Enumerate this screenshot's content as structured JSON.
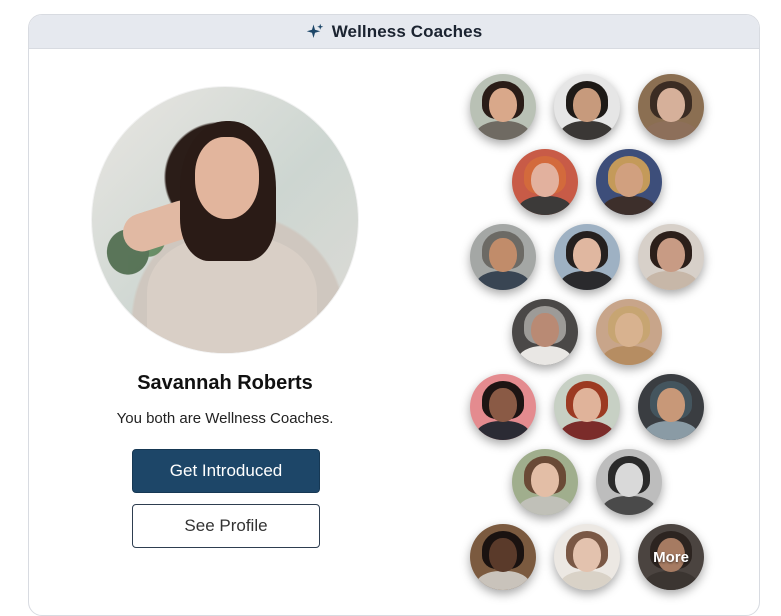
{
  "header": {
    "title": "Wellness Coaches",
    "icon": "sparkle-icon"
  },
  "profile": {
    "name": "Savannah Roberts",
    "subtitle": "You both are Wellness Coaches.",
    "primary_button": "Get Introduced",
    "secondary_button": "See Profile"
  },
  "colors": {
    "primary": "#1d4668",
    "header_bg": "#e6e9ef",
    "border": "#d8dbe1"
  },
  "avatars": [
    {
      "skin": "#d9a88a",
      "hair": "#2a1c17",
      "body": "#6f6a62",
      "bg": "#b9c1b5"
    },
    {
      "skin": "#c79a7c",
      "hair": "#1e1a17",
      "body": "#3a3735",
      "bg": "#e6e6e6"
    },
    {
      "skin": "#d6b09a",
      "hair": "#3b2c23",
      "body": "#8d6f5a",
      "bg": "#8b6f52"
    },
    {
      "skin": "#e2b19e",
      "hair": "#d36a3c",
      "body": "#3c3a39",
      "bg": "#c85b47"
    },
    {
      "skin": "#d1a07f",
      "hair": "#c49a5a",
      "body": "#3d2f2b",
      "bg": "#3d4e7a"
    },
    {
      "skin": "#c18c6a",
      "hair": "#6c6a65",
      "body": "#394553",
      "bg": "#a4a7a5"
    },
    {
      "skin": "#e0b7a0",
      "hair": "#25201f",
      "body": "#2a2a2d",
      "bg": "#9eb1c3"
    },
    {
      "skin": "#c89b84",
      "hair": "#2c1f1a",
      "body": "#c7b7a8",
      "bg": "#d7d0c9"
    },
    {
      "skin": "#b98a74",
      "hair": "#9d9b98",
      "body": "#e9e7e4",
      "bg": "#4a4847"
    },
    {
      "skin": "#d8b28f",
      "hair": "#c7a572",
      "body": "#b68d62",
      "bg": "#c8a58a"
    },
    {
      "skin": "#8a5a45",
      "hair": "#1d1413",
      "body": "#2b2b34",
      "bg": "#e48b8f"
    },
    {
      "skin": "#e0b39a",
      "hair": "#9c3a22",
      "body": "#7b2c2a",
      "bg": "#c7d0c4"
    },
    {
      "skin": "#c89878",
      "hair": "#44555e",
      "body": "#8a9ba5",
      "bg": "#3a3d41"
    },
    {
      "skin": "#e3bea6",
      "hair": "#6a4a36",
      "body": "#c0c0b8",
      "bg": "#a0ae8d"
    },
    {
      "skin": "#d9d9d9",
      "hair": "#2a2a2a",
      "body": "#4a4a4a",
      "bg": "#bdbdbd"
    },
    {
      "skin": "#5a3a2a",
      "hair": "#1a1210",
      "body": "#c9c3bb",
      "bg": "#7b5a3f"
    },
    {
      "skin": "#e3c2ae",
      "hair": "#7a5845",
      "body": "#d9d2c7",
      "bg": "#ece8e3"
    },
    {
      "skin": "#a67b62",
      "hair": "#2c2420",
      "body": "#3b3531",
      "bg": "#4b4440"
    }
  ],
  "more_label": "More"
}
